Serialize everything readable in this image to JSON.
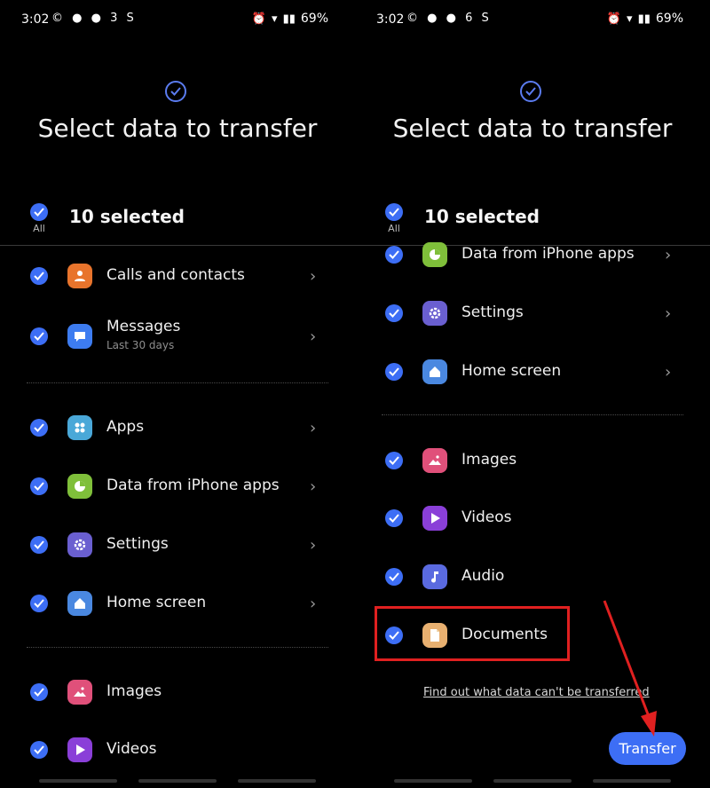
{
  "panels": [
    {
      "status": {
        "time": "3:02",
        "sys_icons": "© ● ● 3 S",
        "battery": "69%"
      },
      "title": "Select data to transfer",
      "header": {
        "all_label": "All",
        "selected": "10 selected"
      },
      "items": [
        {
          "label": "Calls and contacts",
          "sub": "",
          "icon": "contacts-icon",
          "color": "#e8742c"
        },
        {
          "label": "Messages",
          "sub": "Last 30 days",
          "icon": "messages-icon",
          "color": "#3d7cf0"
        },
        {
          "label": "Apps",
          "sub": "",
          "icon": "apps-icon",
          "color": "#4aa8d8"
        },
        {
          "label": "Data from iPhone apps",
          "sub": "",
          "icon": "iphone-data-icon",
          "color": "#7fbf3a"
        },
        {
          "label": "Settings",
          "sub": "",
          "icon": "settings-icon",
          "color": "#6a5fd0"
        },
        {
          "label": "Home screen",
          "sub": "",
          "icon": "home-screen-icon",
          "color": "#4a88e0"
        },
        {
          "label": "Images",
          "sub": "",
          "icon": "images-icon",
          "color": "#e0507a"
        },
        {
          "label": "Videos",
          "sub": "",
          "icon": "videos-icon",
          "color": "#8a3fd8"
        }
      ]
    },
    {
      "status": {
        "time": "3:02",
        "sys_icons": "© ● ● 6 S",
        "battery": "69%"
      },
      "title": "Select data to transfer",
      "header": {
        "all_label": "All",
        "selected": "10 selected"
      },
      "items": [
        {
          "label": "Data from iPhone apps",
          "sub": "",
          "icon": "iphone-data-icon",
          "color": "#7fbf3a"
        },
        {
          "label": "Settings",
          "sub": "",
          "icon": "settings-icon",
          "color": "#6a5fd0"
        },
        {
          "label": "Home screen",
          "sub": "",
          "icon": "home-screen-icon",
          "color": "#4a88e0"
        },
        {
          "label": "Images",
          "sub": "",
          "icon": "images-icon",
          "color": "#e0507a"
        },
        {
          "label": "Videos",
          "sub": "",
          "icon": "videos-icon",
          "color": "#8a3fd8"
        },
        {
          "label": "Audio",
          "sub": "",
          "icon": "audio-icon",
          "color": "#5a6ae0"
        },
        {
          "label": "Documents",
          "sub": "",
          "icon": "documents-icon",
          "color": "#e8b070"
        }
      ],
      "find_out": "Find out what data can't be transferred",
      "transfer": "Transfer"
    }
  ],
  "colors": {
    "accent": "#3d6ef5",
    "highlight": "#e02020"
  }
}
